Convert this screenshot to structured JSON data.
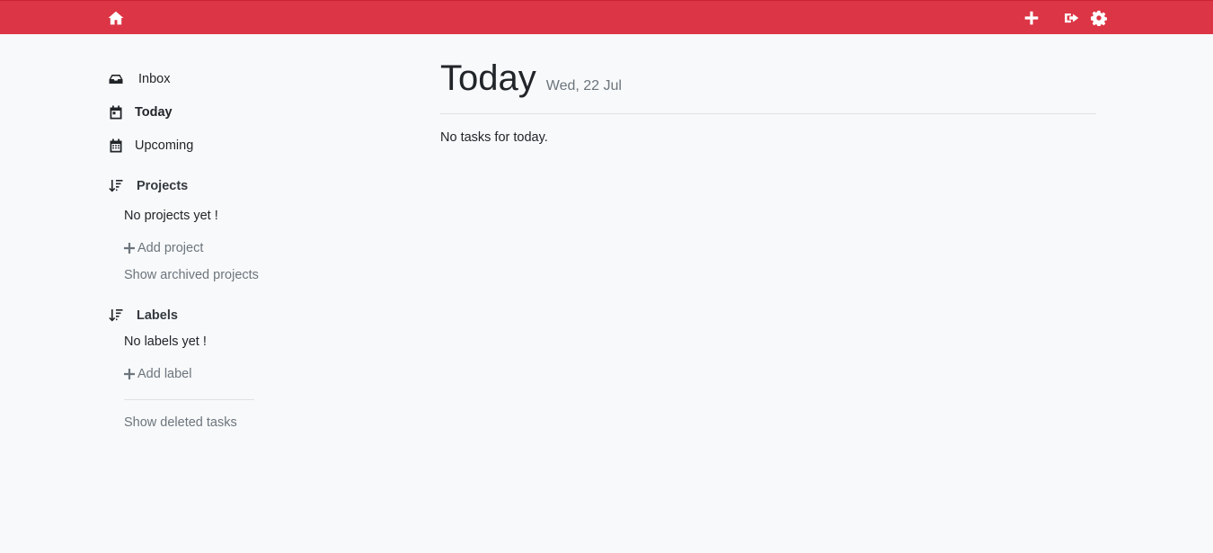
{
  "topbar": {
    "icons": [
      "home-icon",
      "plus-icon",
      "sign-out-icon",
      "gear-icon"
    ],
    "color": "#dc3545"
  },
  "sidebar": {
    "items": [
      {
        "label": "Inbox",
        "icon": "inbox-icon"
      },
      {
        "label": "Today",
        "icon": "calendar-day-icon"
      },
      {
        "label": "Upcoming",
        "icon": "calendar-icon"
      }
    ],
    "projects": {
      "title": "Projects",
      "empty": "No projects yet !",
      "add_label": "Add project",
      "archived_label": "Show archived projects"
    },
    "labels": {
      "title": "Labels",
      "empty": "No labels yet !",
      "add_label": "Add label"
    },
    "deleted_label": "Show deleted tasks"
  },
  "main": {
    "title": "Today",
    "date": "Wed, 22 Jul",
    "empty": "No tasks for today."
  }
}
